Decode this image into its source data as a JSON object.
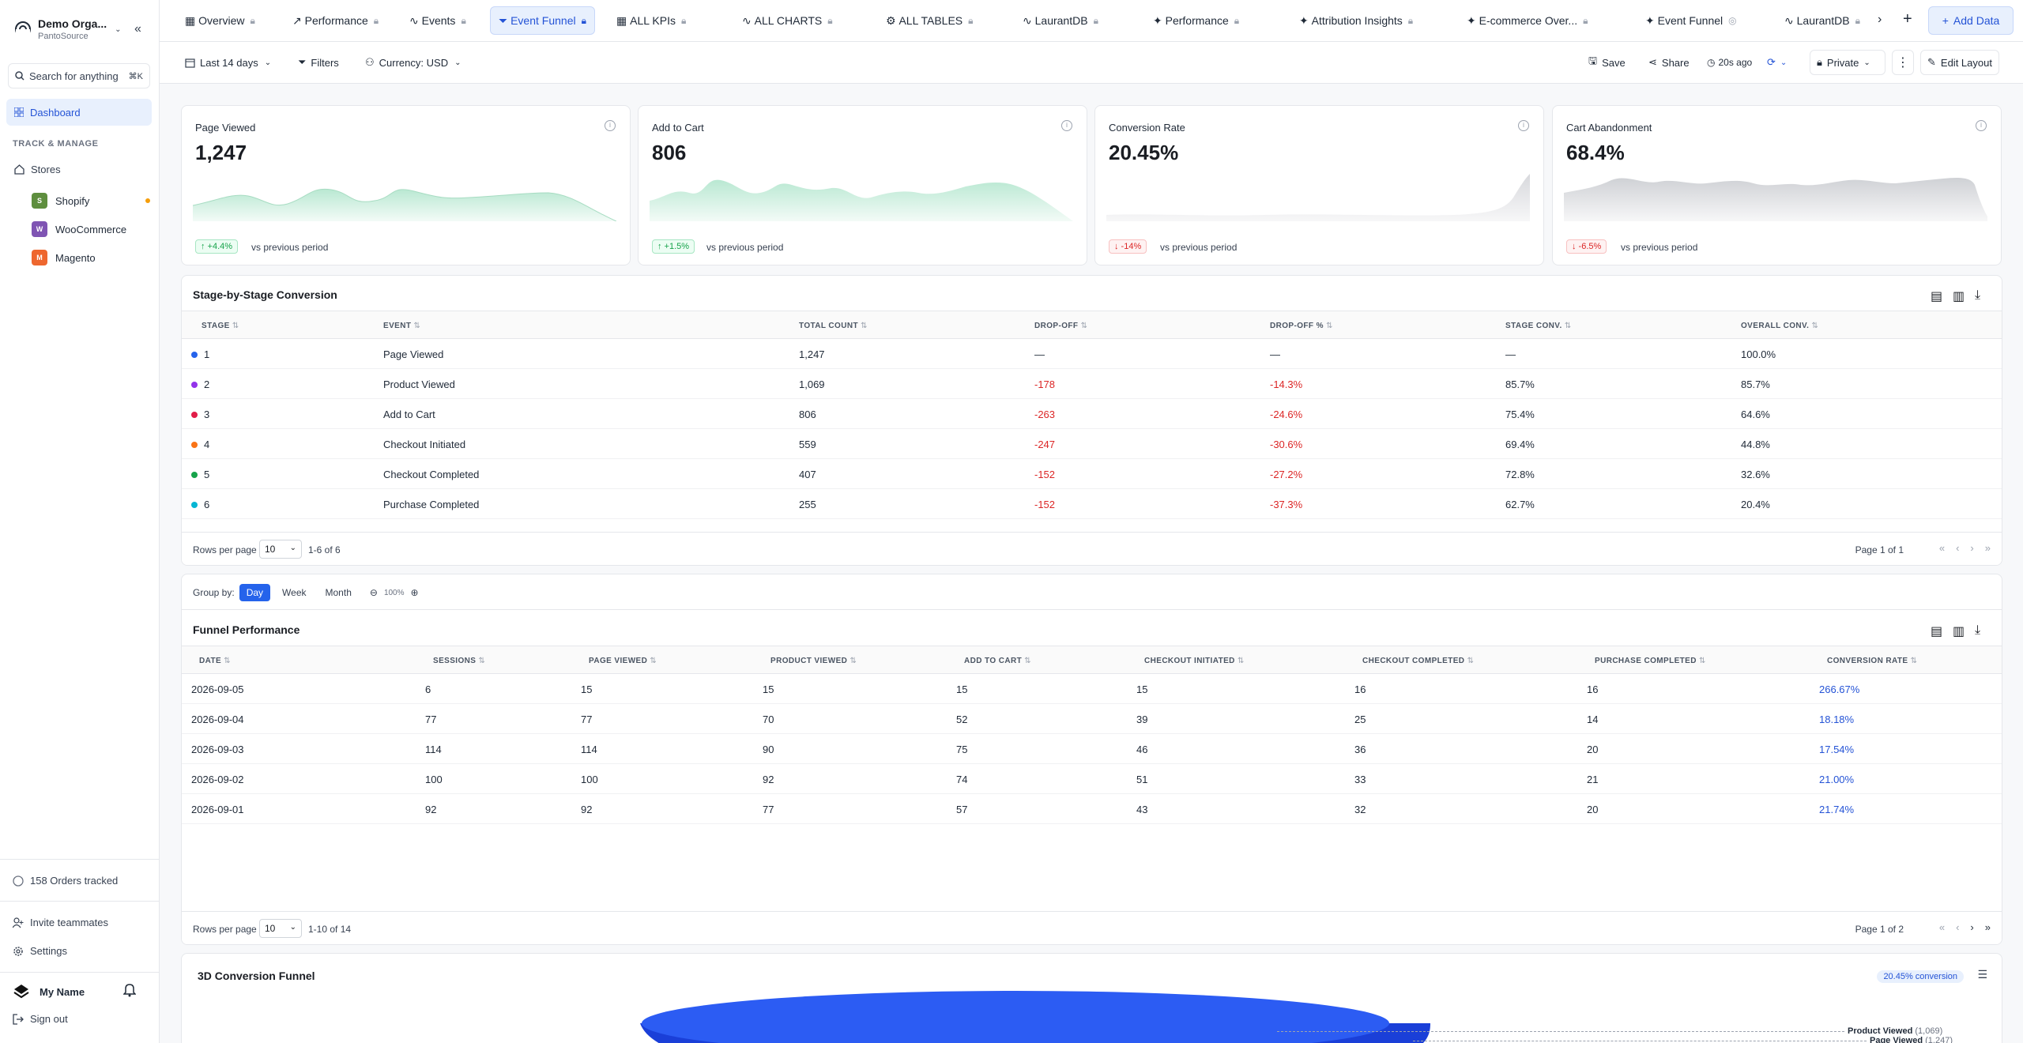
{
  "sidebar": {
    "org_name": "Demo Orga...",
    "org_sub": "PantoSource",
    "search_placeholder": "Search for anything",
    "search_kbd": "⌘K",
    "dashboard_label": "Dashboard",
    "section_header": "TRACK & MANAGE",
    "stores_label": "Stores",
    "stores": [
      {
        "name": "Shopify",
        "color": "#5e8e3e",
        "icon": "shopify-logo"
      },
      {
        "name": "WooCommerce",
        "color": "#7f54b3",
        "icon": "woocommerce-logo"
      },
      {
        "name": "Magento",
        "color": "#ee672f",
        "icon": "magento-logo"
      }
    ],
    "orders_tracked": "158 Orders tracked",
    "invite": "Invite teammates",
    "settings": "Settings",
    "user_name": "My Name",
    "sign_out": "Sign out"
  },
  "tabs": [
    {
      "label": "Overview",
      "icon": "grid-icon",
      "locked": true
    },
    {
      "label": "Performance",
      "icon": "trend-icon",
      "locked": true
    },
    {
      "label": "Events",
      "icon": "activity-icon",
      "locked": true
    },
    {
      "label": "Event Funnel",
      "icon": "funnel-icon",
      "locked": true,
      "active": true
    },
    {
      "label": "ALL KPIs",
      "icon": "grid-icon",
      "locked": true
    },
    {
      "label": "ALL CHARTS",
      "icon": "activity-icon",
      "locked": true
    },
    {
      "label": "ALL TABLES",
      "icon": "gear-icon",
      "locked": true
    },
    {
      "label": "LaurantDB",
      "icon": "activity-icon",
      "locked": true
    },
    {
      "label": "Performance",
      "icon": "sparkle-icon",
      "locked": true
    },
    {
      "label": "Attribution Insights",
      "icon": "sparkle-icon",
      "locked": true
    },
    {
      "label": "E-commerce Over...",
      "icon": "sparkle-icon",
      "locked": true
    },
    {
      "label": "Event Funnel",
      "icon": "sparkle-icon",
      "locked": false
    },
    {
      "label": "LaurantDB",
      "icon": "activity-icon",
      "locked": true
    }
  ],
  "add_data": "Add Data",
  "filters": {
    "date_range": "Last 14 days",
    "filters_label": "Filters",
    "currency_label": "Currency:",
    "currency_value": "USD",
    "save": "Save",
    "share": "Share",
    "refreshed": "20s ago",
    "visibility": "Private",
    "edit_layout": "Edit Layout"
  },
  "kpis": [
    {
      "title": "Page Viewed",
      "value": "1,247",
      "change": "↑ +4.4%",
      "dir": "up",
      "vs": "vs previous period"
    },
    {
      "title": "Add to Cart",
      "value": "806",
      "change": "↑ +1.5%",
      "dir": "up",
      "vs": "vs previous period"
    },
    {
      "title": "Conversion Rate",
      "value": "20.45%",
      "change": "↓ -14%",
      "dir": "down",
      "vs": "vs previous period"
    },
    {
      "title": "Cart Abandonment",
      "value": "68.4%",
      "change": "↓ -6.5%",
      "dir": "down",
      "vs": "vs previous period"
    }
  ],
  "stage_table": {
    "title": "Stage-by-Stage Conversion",
    "columns": [
      "STAGE",
      "EVENT",
      "TOTAL COUNT",
      "DROP-OFF",
      "DROP-OFF %",
      "STAGE CONV.",
      "OVERALL CONV."
    ],
    "rows": [
      {
        "stage": "1",
        "color": "#2563eb",
        "event": "Page Viewed",
        "total": "1,247",
        "drop": "—",
        "drop_pct": "—",
        "stage_conv": "—",
        "overall": "100.0%"
      },
      {
        "stage": "2",
        "color": "#9333ea",
        "event": "Product Viewed",
        "total": "1,069",
        "drop": "-178",
        "drop_pct": "-14.3%",
        "stage_conv": "85.7%",
        "overall": "85.7%"
      },
      {
        "stage": "3",
        "color": "#e11d48",
        "event": "Add to Cart",
        "total": "806",
        "drop": "-263",
        "drop_pct": "-24.6%",
        "stage_conv": "75.4%",
        "overall": "64.6%"
      },
      {
        "stage": "4",
        "color": "#f97316",
        "event": "Checkout Initiated",
        "total": "559",
        "drop": "-247",
        "drop_pct": "-30.6%",
        "stage_conv": "69.4%",
        "overall": "44.8%"
      },
      {
        "stage": "5",
        "color": "#16a34a",
        "event": "Checkout Completed",
        "total": "407",
        "drop": "-152",
        "drop_pct": "-27.2%",
        "stage_conv": "72.8%",
        "overall": "32.6%"
      },
      {
        "stage": "6",
        "color": "#06b6d4",
        "event": "Purchase Completed",
        "total": "255",
        "drop": "-152",
        "drop_pct": "-37.3%",
        "stage_conv": "62.7%",
        "overall": "20.4%"
      }
    ],
    "rows_per_page_label": "Rows per page",
    "rows_per_page": "10",
    "range": "1-6 of 6",
    "page": "Page 1 of 1"
  },
  "group_by": {
    "label": "Group by:",
    "options": [
      "Day",
      "Week",
      "Month"
    ],
    "active": "Day",
    "zoom": "100%"
  },
  "funnel_table": {
    "title": "Funnel Performance",
    "columns": [
      "DATE",
      "SESSIONS",
      "PAGE VIEWED",
      "PRODUCT VIEWED",
      "ADD TO CART",
      "CHECKOUT INITIATED",
      "CHECKOUT COMPLETED",
      "PURCHASE COMPLETED",
      "CONVERSION RATE"
    ],
    "rows": [
      [
        "2026-09-05",
        "6",
        "15",
        "15",
        "15",
        "15",
        "16",
        "16",
        "266.67%"
      ],
      [
        "2026-09-04",
        "77",
        "77",
        "70",
        "52",
        "39",
        "25",
        "14",
        "18.18%"
      ],
      [
        "2026-09-03",
        "114",
        "114",
        "90",
        "75",
        "46",
        "36",
        "20",
        "17.54%"
      ],
      [
        "2026-09-02",
        "100",
        "100",
        "92",
        "74",
        "51",
        "33",
        "21",
        "21.00%"
      ],
      [
        "2026-09-01",
        "92",
        "92",
        "77",
        "57",
        "43",
        "32",
        "20",
        "21.74%"
      ]
    ],
    "rows_per_page_label": "Rows per page",
    "rows_per_page": "10",
    "range": "1-10 of 14",
    "page": "Page 1 of 2"
  },
  "funnel3d": {
    "title": "3D Conversion Funnel",
    "badge": "20.45% conversion",
    "labels": [
      {
        "name": "Page Viewed",
        "count": "(1,247)"
      },
      {
        "name": "Product Viewed",
        "count": "(1,069)"
      }
    ]
  }
}
